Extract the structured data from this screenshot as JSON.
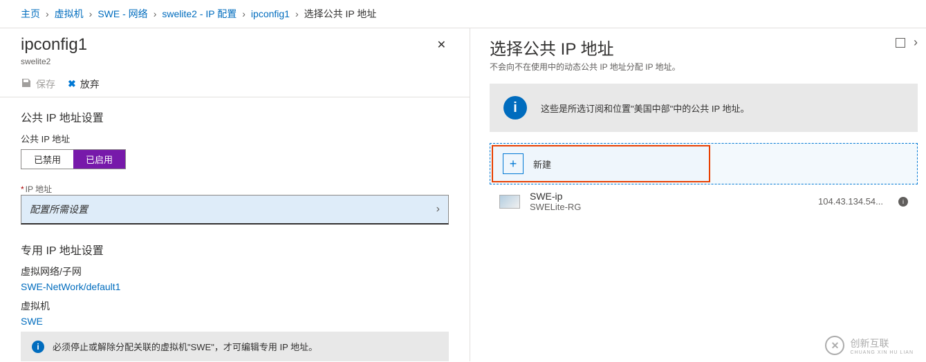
{
  "breadcrumb": {
    "items": [
      "主页",
      "虚拟机",
      "SWE - 网络",
      "swelite2 - IP 配置",
      "ipconfig1"
    ],
    "current": "选择公共 IP 地址"
  },
  "left": {
    "title": "ipconfig1",
    "subtitle": "swelite2",
    "toolbar": {
      "save": "保存",
      "discard": "放弃"
    },
    "section1_title": "公共 IP 地址设置",
    "pubip_label": "公共 IP 地址",
    "toggle": {
      "disabled": "已禁用",
      "enabled": "已启用"
    },
    "ipaddr_label": "IP 地址",
    "ipaddr_placeholder": "配置所需设置",
    "section2_title": "专用 IP 地址设置",
    "vnet_label": "虚拟网络/子网",
    "vnet_link": "SWE-NetWork/default1",
    "vm_label": "虚拟机",
    "vm_link": "SWE",
    "warning": "必须停止或解除分配关联的虚拟机\"SWE\"，才可编辑专用 IP 地址。"
  },
  "right": {
    "title": "选择公共 IP 地址",
    "subtitle": "不会向不在使用中的动态公共 IP 地址分配 IP 地址。",
    "notice": "这些是所选订阅和位置\"美国中部\"中的公共 IP 地址。",
    "new_label": "新建",
    "ip_list": [
      {
        "name": "SWE-ip",
        "rg": "SWELite-RG",
        "addr": "104.43.134.54..."
      }
    ]
  },
  "watermark": {
    "brand": "创新互联",
    "sub": "CHUANG XIN HU LIAN"
  }
}
